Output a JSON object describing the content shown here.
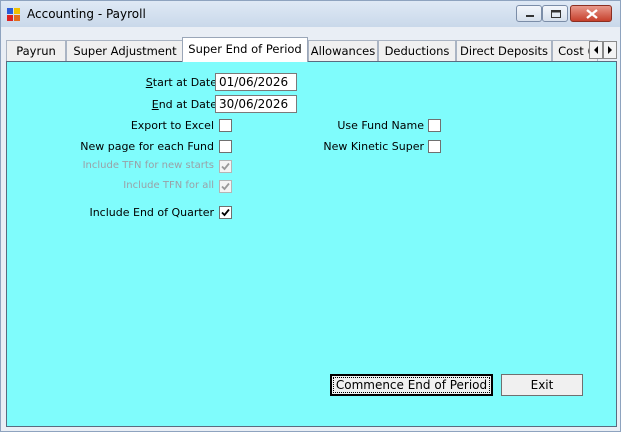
{
  "window": {
    "title": "Accounting - Payroll"
  },
  "tabs": [
    {
      "label": "Payrun"
    },
    {
      "label": "Super Adjustment"
    },
    {
      "label": "Super End of Period"
    },
    {
      "label": "Allowances"
    },
    {
      "label": "Deductions"
    },
    {
      "label": "Direct Deposits"
    },
    {
      "label": "Cost ("
    }
  ],
  "form": {
    "start_date": {
      "label_mnemonic": "S",
      "label_rest": "tart at Date",
      "value": "01/06/2026"
    },
    "end_date": {
      "label_mnemonic": "E",
      "label_rest": "nd at Date",
      "value": "30/06/2026"
    },
    "export_to_excel": {
      "label": "Export to Excel",
      "checked": false
    },
    "new_page_each_fund": {
      "label": "New page for each Fund",
      "checked": false
    },
    "include_tfn_new_starts": {
      "label": "Include TFN for new starts",
      "checked": true,
      "enabled": false
    },
    "include_tfn_all": {
      "label": "Include TFN for all",
      "checked": true,
      "enabled": false
    },
    "include_end_of_quarter": {
      "label": "Include End of Quarter",
      "checked": true
    },
    "use_fund_name": {
      "label": "Use Fund Name",
      "checked": false
    },
    "new_kinetic_super": {
      "label": "New Kinetic Super",
      "checked": false
    }
  },
  "buttons": {
    "commence": "Commence End of Period",
    "exit": "Exit"
  },
  "colors": {
    "panel_background": "#7ffcfc",
    "window_frame": "#e9eef5"
  }
}
